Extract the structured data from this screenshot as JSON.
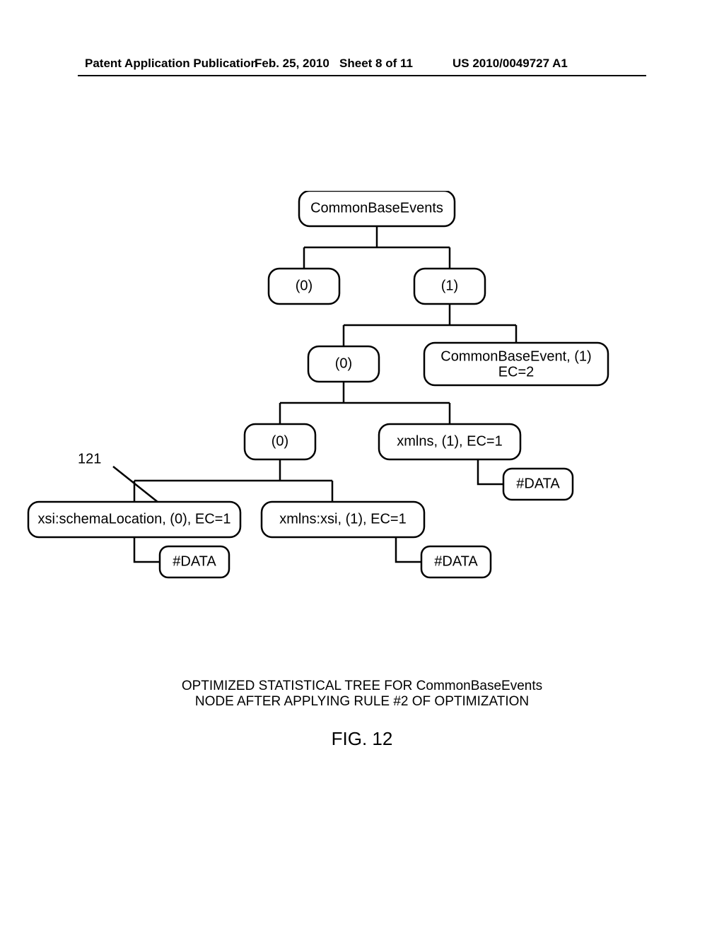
{
  "header": {
    "left": "Patent Application Publication",
    "mid_date": "Feb. 25, 2010",
    "mid_sheet": "Sheet 8 of 11",
    "right": "US 2010/0049727 A1"
  },
  "annotation": "121",
  "nodes": {
    "root": "CommonBaseEvents",
    "l2_left": "(0)",
    "l2_right": "(1)",
    "l3_left": "(0)",
    "l3_right_line1": "CommonBaseEvent, (1)",
    "l3_right_line2": "EC=2",
    "l4_left": "(0)",
    "l4_right": "xmlns, (1), EC=1",
    "l5_left": "xsi:schemaLocation, (0), EC=1",
    "l5_right": "xmlns:xsi, (1), EC=1",
    "data": "#DATA"
  },
  "caption_line1": "OPTIMIZED STATISTICAL TREE FOR CommonBaseEvents",
  "caption_line2": "NODE AFTER APPLYING RULE #2 OF OPTIMIZATION",
  "figure_label": "FIG. 12"
}
